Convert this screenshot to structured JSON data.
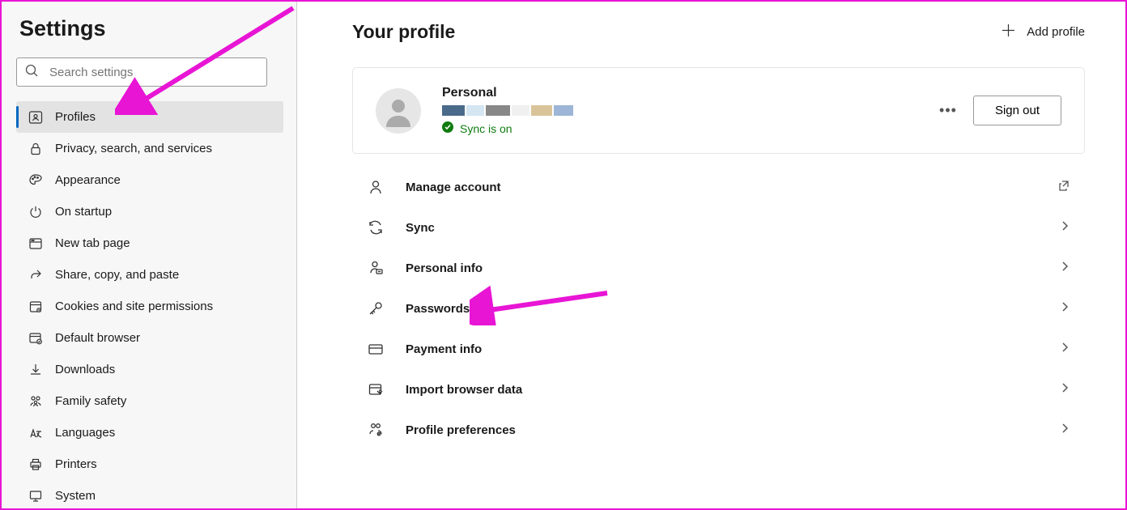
{
  "sidebar": {
    "title": "Settings",
    "search_placeholder": "Search settings",
    "items": [
      {
        "label": "Profiles"
      },
      {
        "label": "Privacy, search, and services"
      },
      {
        "label": "Appearance"
      },
      {
        "label": "On startup"
      },
      {
        "label": "New tab page"
      },
      {
        "label": "Share, copy, and paste"
      },
      {
        "label": "Cookies and site permissions"
      },
      {
        "label": "Default browser"
      },
      {
        "label": "Downloads"
      },
      {
        "label": "Family safety"
      },
      {
        "label": "Languages"
      },
      {
        "label": "Printers"
      },
      {
        "label": "System"
      }
    ]
  },
  "main": {
    "title": "Your profile",
    "add_profile": "Add profile",
    "profile": {
      "name": "Personal",
      "sync": "Sync is on",
      "signout": "Sign out"
    },
    "menu": [
      {
        "label": "Manage account"
      },
      {
        "label": "Sync"
      },
      {
        "label": "Personal info"
      },
      {
        "label": "Passwords"
      },
      {
        "label": "Payment info"
      },
      {
        "label": "Import browser data"
      },
      {
        "label": "Profile preferences"
      }
    ]
  }
}
